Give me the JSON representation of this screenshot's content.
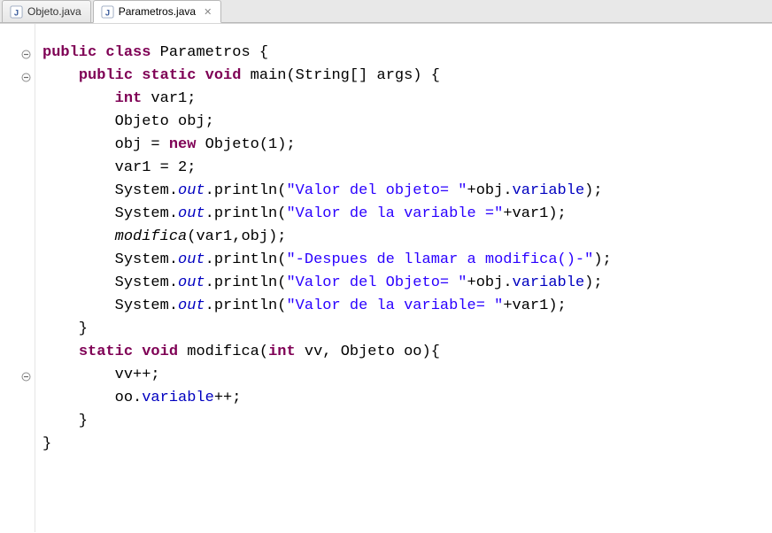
{
  "tabs": [
    {
      "label": "Objeto.java",
      "active": false
    },
    {
      "label": "Parametros.java",
      "active": true
    }
  ],
  "code": {
    "lines": [
      {
        "fold": "minus",
        "tokens": [
          {
            "t": "kw",
            "v": "public"
          },
          {
            "t": "p",
            "v": " "
          },
          {
            "t": "kw",
            "v": "class"
          },
          {
            "t": "p",
            "v": " Parametros {"
          }
        ]
      },
      {
        "fold": "minus",
        "tokens": [
          {
            "t": "p",
            "v": "    "
          },
          {
            "t": "kw",
            "v": "public"
          },
          {
            "t": "p",
            "v": " "
          },
          {
            "t": "kw",
            "v": "static"
          },
          {
            "t": "p",
            "v": " "
          },
          {
            "t": "kw",
            "v": "void"
          },
          {
            "t": "p",
            "v": " main(String[] args) {"
          }
        ]
      },
      {
        "tokens": [
          {
            "t": "p",
            "v": "        "
          },
          {
            "t": "kw",
            "v": "int"
          },
          {
            "t": "p",
            "v": " var1;"
          }
        ]
      },
      {
        "tokens": [
          {
            "t": "p",
            "v": "        Objeto obj;"
          }
        ]
      },
      {
        "tokens": [
          {
            "t": "p",
            "v": "        obj = "
          },
          {
            "t": "kw",
            "v": "new"
          },
          {
            "t": "p",
            "v": " Objeto(1);"
          }
        ]
      },
      {
        "tokens": [
          {
            "t": "p",
            "v": "        var1 = 2;"
          }
        ]
      },
      {
        "tokens": [
          {
            "t": "p",
            "v": "        System."
          },
          {
            "t": "sfld",
            "v": "out"
          },
          {
            "t": "p",
            "v": ".println("
          },
          {
            "t": "str",
            "v": "\"Valor del objeto= \""
          },
          {
            "t": "p",
            "v": "+obj."
          },
          {
            "t": "fld",
            "v": "variable"
          },
          {
            "t": "p",
            "v": ");"
          }
        ]
      },
      {
        "tokens": [
          {
            "t": "p",
            "v": "        System."
          },
          {
            "t": "sfld",
            "v": "out"
          },
          {
            "t": "p",
            "v": ".println("
          },
          {
            "t": "str",
            "v": "\"Valor de la variable =\""
          },
          {
            "t": "p",
            "v": "+var1);"
          }
        ]
      },
      {
        "tokens": [
          {
            "t": "p",
            "v": "        "
          },
          {
            "t": "smtd",
            "v": "modifica"
          },
          {
            "t": "p",
            "v": "(var1,obj);"
          }
        ]
      },
      {
        "tokens": [
          {
            "t": "p",
            "v": "        System."
          },
          {
            "t": "sfld",
            "v": "out"
          },
          {
            "t": "p",
            "v": ".println("
          },
          {
            "t": "str",
            "v": "\"-Despues de llamar a modifica()-\""
          },
          {
            "t": "p",
            "v": ");"
          }
        ]
      },
      {
        "tokens": [
          {
            "t": "p",
            "v": "        System."
          },
          {
            "t": "sfld",
            "v": "out"
          },
          {
            "t": "p",
            "v": ".println("
          },
          {
            "t": "str",
            "v": "\"Valor del Objeto= \""
          },
          {
            "t": "p",
            "v": "+obj."
          },
          {
            "t": "fld",
            "v": "variable"
          },
          {
            "t": "p",
            "v": ");"
          }
        ]
      },
      {
        "tokens": [
          {
            "t": "p",
            "v": "        System."
          },
          {
            "t": "sfld",
            "v": "out"
          },
          {
            "t": "p",
            "v": ".println("
          },
          {
            "t": "str",
            "v": "\"Valor de la variable= \""
          },
          {
            "t": "p",
            "v": "+var1);"
          }
        ]
      },
      {
        "tokens": [
          {
            "t": "p",
            "v": ""
          }
        ]
      },
      {
        "tokens": [
          {
            "t": "p",
            "v": "    }"
          }
        ]
      },
      {
        "fold": "minus",
        "tokens": [
          {
            "t": "p",
            "v": "    "
          },
          {
            "t": "kw",
            "v": "static"
          },
          {
            "t": "p",
            "v": " "
          },
          {
            "t": "kw",
            "v": "void"
          },
          {
            "t": "p",
            "v": " modifica("
          },
          {
            "t": "kw",
            "v": "int"
          },
          {
            "t": "p",
            "v": " vv, Objeto oo){"
          }
        ]
      },
      {
        "tokens": [
          {
            "t": "p",
            "v": "        vv++;"
          }
        ]
      },
      {
        "tokens": [
          {
            "t": "p",
            "v": "        oo."
          },
          {
            "t": "fld",
            "v": "variable"
          },
          {
            "t": "p",
            "v": "++;"
          }
        ]
      },
      {
        "tokens": [
          {
            "t": "p",
            "v": "    }"
          }
        ]
      },
      {
        "tokens": [
          {
            "t": "p",
            "v": ""
          }
        ]
      },
      {
        "tokens": [
          {
            "t": "p",
            "v": "}"
          }
        ]
      }
    ]
  }
}
